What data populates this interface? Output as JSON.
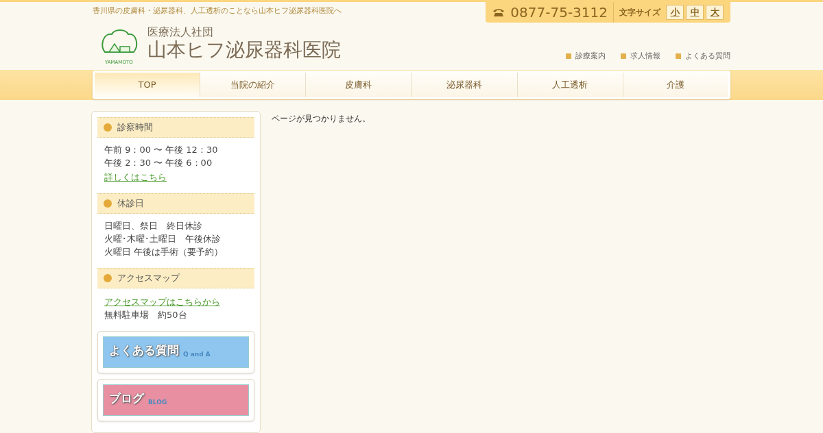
{
  "tagline": "香川県の皮膚科・泌尿器科、人工透析のことなら山本ヒフ泌尿器科医院へ",
  "logo": {
    "mark_text": "YAMAMOTO",
    "subtitle": "医療法人社団",
    "title": "山本ヒフ泌尿器科医院"
  },
  "phone": "0877-75-3112",
  "font_size": {
    "label": "文字サイズ",
    "options": [
      "小",
      "中",
      "大"
    ]
  },
  "header_links": [
    "診療案内",
    "求人情報",
    "よくある質問"
  ],
  "nav": [
    {
      "label": "TOP",
      "selected": true
    },
    {
      "label": "当院の紹介",
      "selected": false
    },
    {
      "label": "皮膚科",
      "selected": false
    },
    {
      "label": "泌尿器科",
      "selected": false
    },
    {
      "label": "人工透析",
      "selected": false
    },
    {
      "label": "介護",
      "selected": false
    }
  ],
  "sidebar": {
    "sections": [
      {
        "title": "診察時間",
        "lines": [
          {
            "kind": "text",
            "text": "午前 9：00 〜 午後 12：30"
          },
          {
            "kind": "text",
            "text": "午後 2：30 〜 午後 6：00"
          },
          {
            "kind": "link",
            "text": "詳しくはこちら"
          }
        ]
      },
      {
        "title": "休診日",
        "lines": [
          {
            "kind": "text",
            "text": "日曜日、祭日　終日休診"
          },
          {
            "kind": "text",
            "text": "火曜･木曜･土曜日　午後休診"
          },
          {
            "kind": "text",
            "text": "火曜日 午後は手術（要予約）"
          }
        ]
      },
      {
        "title": "アクセスマップ",
        "lines": [
          {
            "kind": "link",
            "text": "アクセスマップはこちらから"
          },
          {
            "kind": "text",
            "text": "無料駐車場　約50台"
          }
        ]
      }
    ],
    "banners": [
      {
        "title": "よくある質問",
        "sub": "Q and A",
        "color": "#8ec6f0"
      },
      {
        "title": "ブログ",
        "sub": "BLOG",
        "color": "#e98fa2"
      }
    ]
  },
  "main": {
    "message": "ページが見つかりません。"
  }
}
